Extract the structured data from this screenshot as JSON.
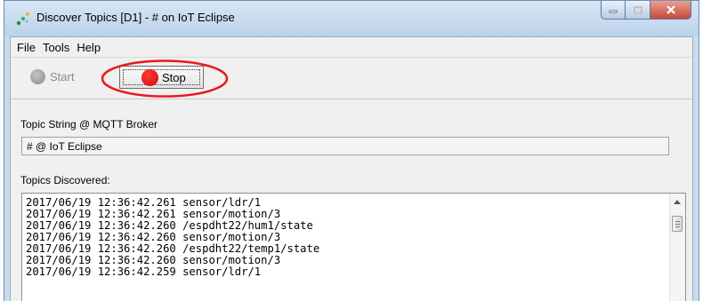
{
  "window": {
    "title": "Discover Topics [D1] - # on IoT Eclipse"
  },
  "menu": [
    "File",
    "Tools",
    "Help"
  ],
  "toolbar": {
    "start_label": "Start",
    "stop_label": "Stop"
  },
  "topic_string": {
    "label": "Topic String @ MQTT Broker",
    "value": "# @ IoT Eclipse"
  },
  "topics_discovered": {
    "label": "Topics Discovered:",
    "lines": [
      "2017/06/19 12:36:42.261 sensor/ldr/1",
      "2017/06/19 12:36:42.261 sensor/motion/3",
      "2017/06/19 12:36:42.260 /espdht22/hum1/state",
      "2017/06/19 12:36:42.260 sensor/motion/3",
      "2017/06/19 12:36:42.260 /espdht22/temp1/state",
      "2017/06/19 12:36:42.260 sensor/motion/3",
      "2017/06/19 12:36:42.259 sensor/ldr/1"
    ]
  },
  "colors": {
    "annotation": "#e8181e",
    "stop_indicator": "#ff0000",
    "start_indicator": "#a0a0a0"
  },
  "icons": [
    "app-icon",
    "minimize-icon",
    "maximize-icon",
    "close-icon",
    "scroll-up-icon"
  ]
}
